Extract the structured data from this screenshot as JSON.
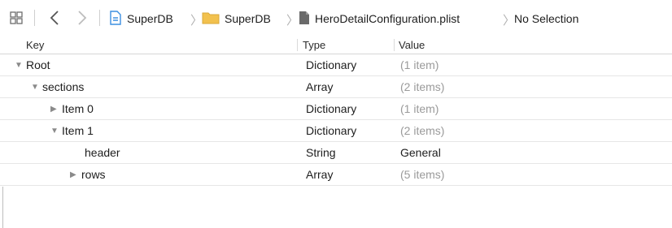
{
  "jumpbar": {
    "breadcrumbs": [
      {
        "label": "SuperDB",
        "icon": "project-icon"
      },
      {
        "label": "SuperDB",
        "icon": "folder-icon"
      },
      {
        "label": "HeroDetailConfiguration.plist",
        "icon": "file-icon"
      },
      {
        "label": "No Selection",
        "icon": ""
      }
    ]
  },
  "table": {
    "columns": [
      "Key",
      "Type",
      "Value"
    ],
    "rows": [
      {
        "key": "Root",
        "type": "Dictionary",
        "value": "(1 item)",
        "disclosure": "expanded"
      },
      {
        "key": "sections",
        "type": "Array",
        "value": "(2 items)",
        "disclosure": "expanded"
      },
      {
        "key": "Item 0",
        "type": "Dictionary",
        "value": "(1 item)",
        "disclosure": "collapsed"
      },
      {
        "key": "Item 1",
        "type": "Dictionary",
        "value": "(2 items)",
        "disclosure": "expanded"
      },
      {
        "key": "header",
        "type": "String",
        "value": "General",
        "disclosure": "none"
      },
      {
        "key": "rows",
        "type": "Array",
        "value": "(5 items)",
        "disclosure": "collapsed"
      }
    ]
  },
  "colors": {
    "folder": "#f2c14e",
    "project": "#3b8fe0",
    "disclosure": "#8a8a8a",
    "muted_value": "#9a9a9a"
  }
}
